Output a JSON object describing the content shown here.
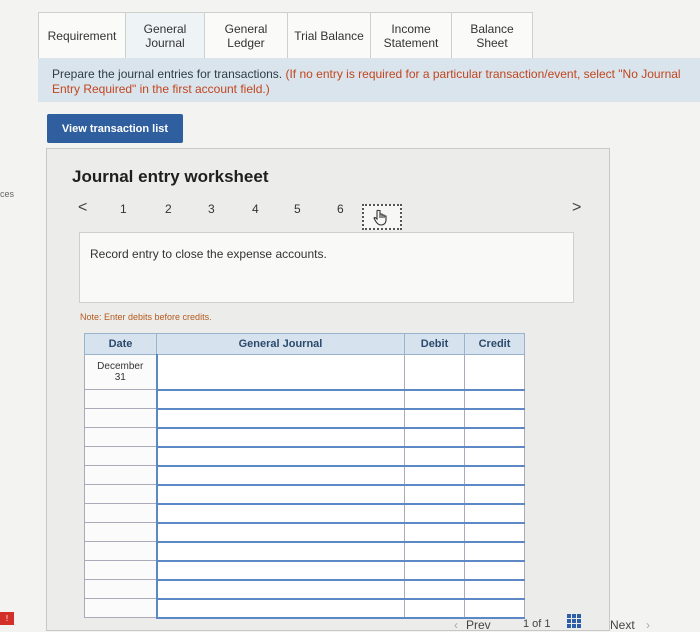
{
  "tabs": [
    {
      "label": "Requirement",
      "width": 88
    },
    {
      "label": "General\nJournal",
      "width": 80
    },
    {
      "label": "General\nLedger",
      "width": 84
    },
    {
      "label": "Trial Balance",
      "width": 84
    },
    {
      "label": "Income\nStatement",
      "width": 82
    },
    {
      "label": "Balance Sheet",
      "width": 82
    }
  ],
  "instructions": {
    "prefix": "Prepare the journal entries for transactions. ",
    "emphasis": "(If no entry is required for a particular transaction/event, select \"No Journal Entry Required\" in the first account field.)"
  },
  "view_button": "View transaction list",
  "side_text": "ces",
  "worksheet": {
    "title": "Journal entry worksheet",
    "pages": [
      "1",
      "2",
      "3",
      "4",
      "5",
      "6"
    ],
    "prev_arrow": "<",
    "next_arrow": ">",
    "entry_text": "Record entry to close the expense accounts.",
    "note": "Note: Enter debits before credits."
  },
  "table": {
    "headers": {
      "date": "Date",
      "journal": "General Journal",
      "debit": "Debit",
      "credit": "Credit"
    },
    "first_date": "December\n31"
  },
  "footer": {
    "prev": "Prev",
    "page_of": "1 of 1",
    "next": "Next"
  }
}
